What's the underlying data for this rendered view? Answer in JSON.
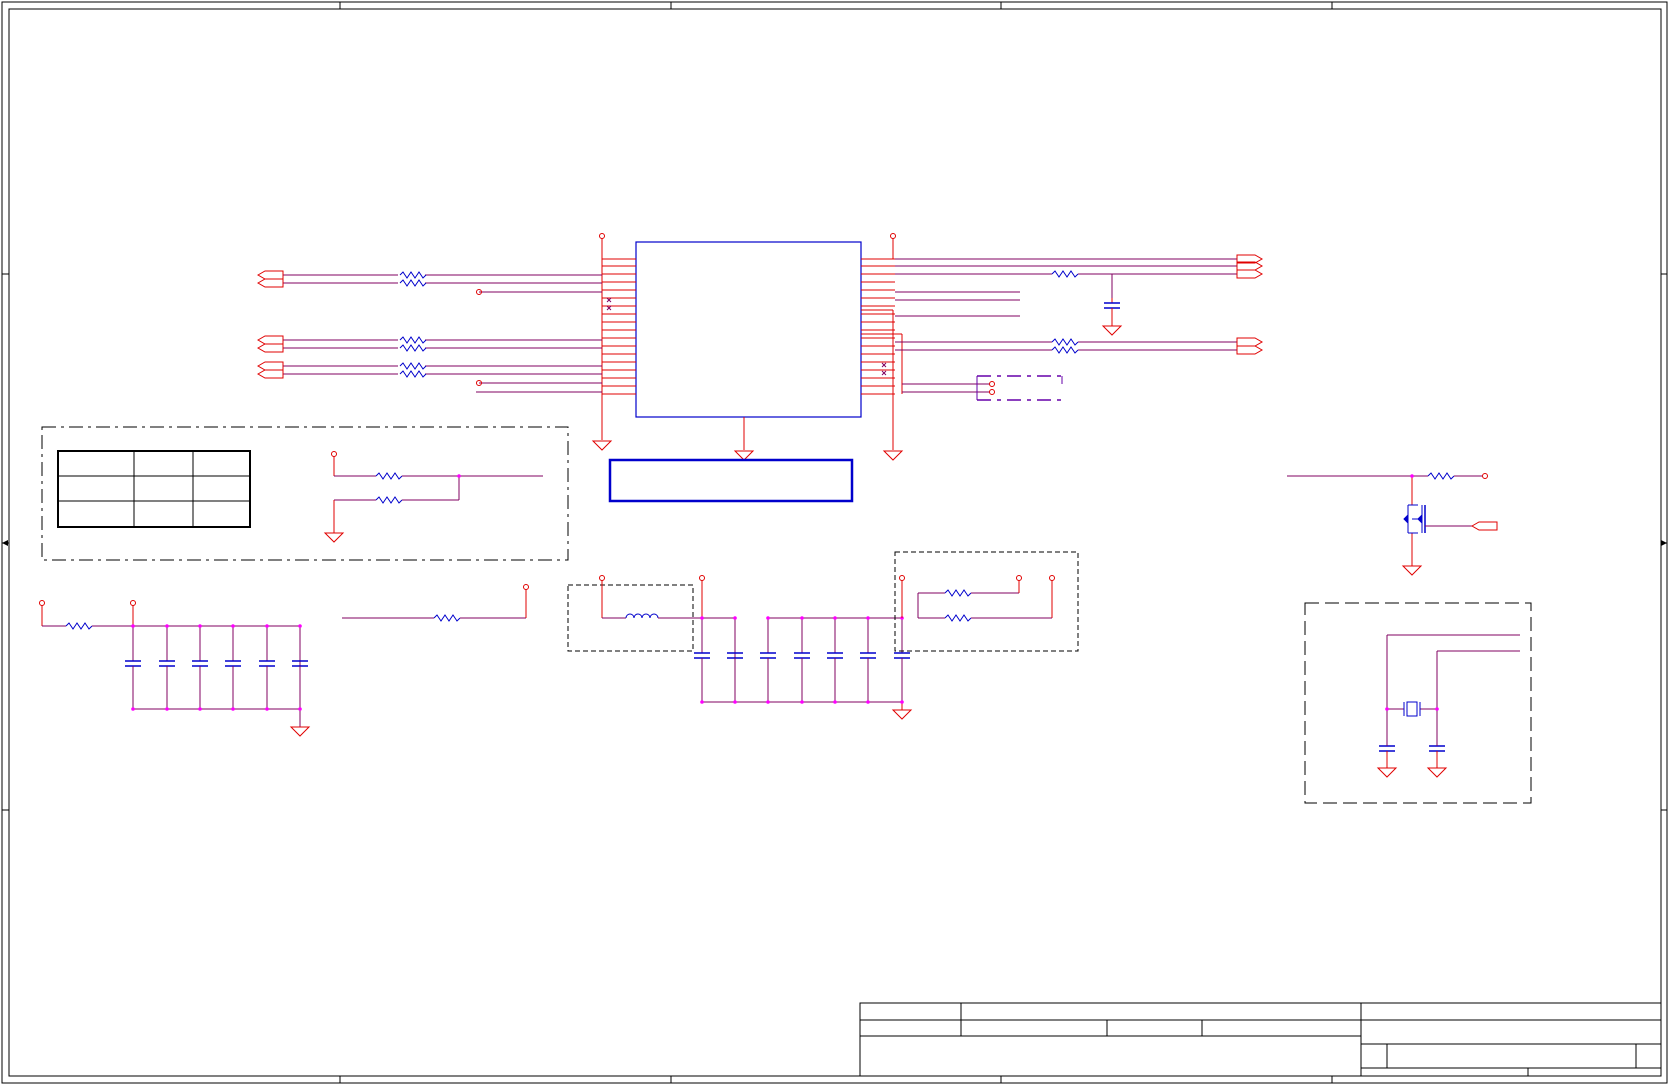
{
  "sheet": {
    "title": "",
    "note": "",
    "table": [
      [
        "",
        "",
        ""
      ],
      [
        "",
        "",
        ""
      ],
      [
        "",
        "",
        ""
      ]
    ]
  },
  "title_block": {
    "cells": [
      "",
      "",
      "",
      "",
      "",
      "",
      "",
      ""
    ]
  },
  "colors": {
    "wire": "#e00000",
    "net": "#800060",
    "body": "#0000cc",
    "junction": "#ff00ff",
    "frame": "#000000",
    "dashed_box": "#000000",
    "connector": "#6600aa"
  },
  "icons": {
    "ground": "ground-symbol",
    "resistor": "resistor-symbol",
    "capacitor": "capacitor-symbol",
    "inductor": "inductor-symbol",
    "crystal": "crystal-symbol",
    "mosfet": "mosfet-symbol",
    "power": "power-pin-symbol",
    "port": "port-symbol"
  }
}
